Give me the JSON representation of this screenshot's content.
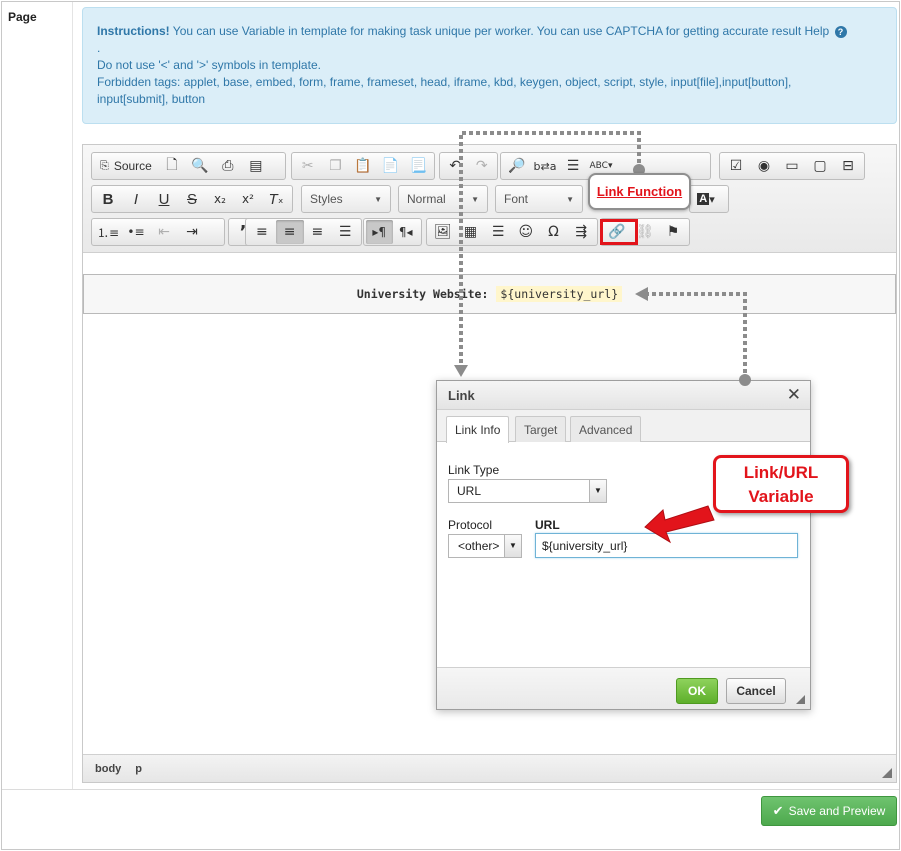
{
  "page": {
    "label": "Page"
  },
  "instructions": {
    "label": "Instructions!",
    "line1": "You can use Variable in template for making task unique per worker. You can use CAPTCHA for getting accurate result Help",
    "help_icon": "question-circle-icon",
    "dot": ".",
    "line2": "Do not use '<' and '>' symbols in template.",
    "line3": "Forbidden tags: applet, base, embed, form, frame, frameset, head, iframe, kbd, keygen, object, script, style, input[file],input[button],",
    "line4": "input[submit], button"
  },
  "toolbar": {
    "source_label": "Source",
    "styles_label": "Styles",
    "format_label": "Normal",
    "font_label": "Font"
  },
  "content": {
    "placeholder_label": "University Website:",
    "placeholder_var": "${university_url}"
  },
  "statusbar": {
    "path": [
      "body",
      "p"
    ]
  },
  "dialog": {
    "title": "Link",
    "tabs": [
      "Link Info",
      "Target",
      "Advanced"
    ],
    "link_type_label": "Link Type",
    "link_type_value": "URL",
    "protocol_label": "Protocol",
    "protocol_value": "<other>",
    "url_label": "URL",
    "url_value": "${university_url}",
    "ok_label": "OK",
    "cancel_label": "Cancel"
  },
  "save_button": {
    "label": "Save and Preview"
  },
  "annotations": {
    "link_function": "Link Function",
    "url_variable_line1": "Link/URL",
    "url_variable_line2": "Variable",
    "arrow_color": "#e2141b",
    "connector_color": "#8c8c8c"
  }
}
